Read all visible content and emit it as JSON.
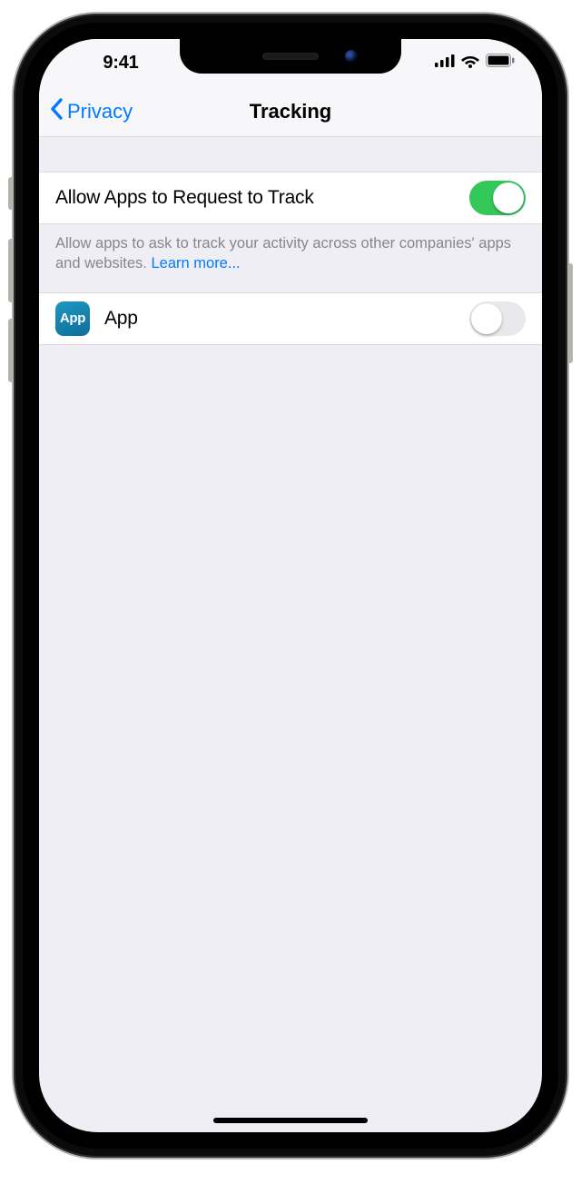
{
  "status": {
    "time": "9:41"
  },
  "nav": {
    "back_label": "Privacy",
    "title": "Tracking"
  },
  "master_toggle": {
    "label": "Allow Apps to Request to Track",
    "on": true
  },
  "footer": {
    "text": "Allow apps to ask to track your activity across other companies' apps and websites. ",
    "link": "Learn more..."
  },
  "apps": [
    {
      "icon_text": "App",
      "name": "App",
      "on": false
    }
  ],
  "colors": {
    "accent": "#007aff",
    "toggle_on": "#34c759",
    "bg": "#efeef5"
  }
}
